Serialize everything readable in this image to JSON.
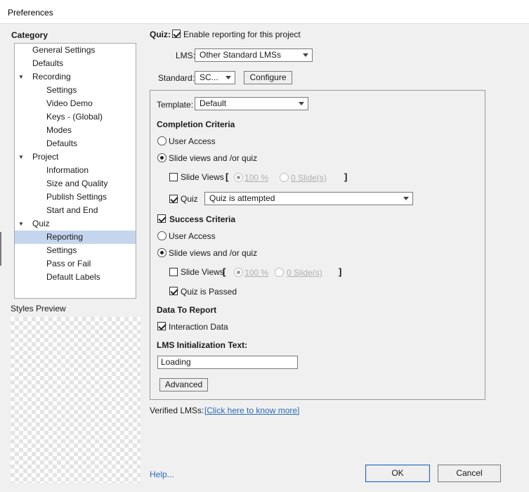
{
  "window": {
    "title": "Preferences"
  },
  "sidebar": {
    "category_label": "Category",
    "items": [
      {
        "label": "General Settings"
      },
      {
        "label": "Defaults"
      },
      {
        "label": "Recording"
      },
      {
        "label": "Settings"
      },
      {
        "label": "Video Demo"
      },
      {
        "label": "Keys - (Global)"
      },
      {
        "label": "Modes"
      },
      {
        "label": "Defaults"
      },
      {
        "label": "Project"
      },
      {
        "label": "Information"
      },
      {
        "label": "Size and Quality"
      },
      {
        "label": "Publish Settings"
      },
      {
        "label": "Start and End"
      },
      {
        "label": "Quiz"
      },
      {
        "label": "Reporting"
      },
      {
        "label": "Settings"
      },
      {
        "label": "Pass or Fail"
      },
      {
        "label": "Default Labels"
      }
    ],
    "expander_glyph": "▼",
    "selected": "Reporting",
    "styles_preview_label": "Styles Preview"
  },
  "quiz": {
    "label": "Quiz:",
    "enable_reporting_label": "Enable reporting for this project",
    "enable_reporting_checked": true
  },
  "lms": {
    "label": "LMS:",
    "value": "Other Standard LMSs"
  },
  "standard": {
    "label": "Standard:",
    "value": "SC...",
    "configure_label": "Configure"
  },
  "template": {
    "label": "Template:",
    "value": "Default"
  },
  "completion": {
    "heading": "Completion Criteria",
    "user_access_label": "User Access",
    "slide_views_quiz_label": "Slide views and /or quiz",
    "slide_views_label": "Slide Views",
    "bracket_open": "[",
    "bracket_close": "]",
    "percent_value": "100 %",
    "slides_value": "0 Slide(s)",
    "quiz_label": "Quiz",
    "quiz_checked": true,
    "quiz_condition": "Quiz is attempted"
  },
  "success": {
    "heading": "Success Criteria",
    "heading_checked": true,
    "user_access_label": "User Access",
    "slide_views_quiz_label": "Slide views and /or quiz",
    "slide_views_label": "Slide Views",
    "bracket_open": "[",
    "bracket_close": "]",
    "percent_value": "100 %",
    "slides_value": "0 Slide(s)",
    "quiz_passed_label": "Quiz is Passed",
    "quiz_passed_checked": true
  },
  "data_to_report": {
    "heading": "Data To Report",
    "interaction_data_label": "Interaction Data",
    "interaction_data_checked": true
  },
  "lms_init": {
    "heading": "LMS Initialization Text:",
    "value": "Loading"
  },
  "advanced_label": "Advanced",
  "verified": {
    "label": "Verified LMSs:",
    "link": "[Click here to know more]"
  },
  "footer": {
    "help_label": "Help...",
    "ok_label": "OK",
    "cancel_label": "Cancel"
  }
}
